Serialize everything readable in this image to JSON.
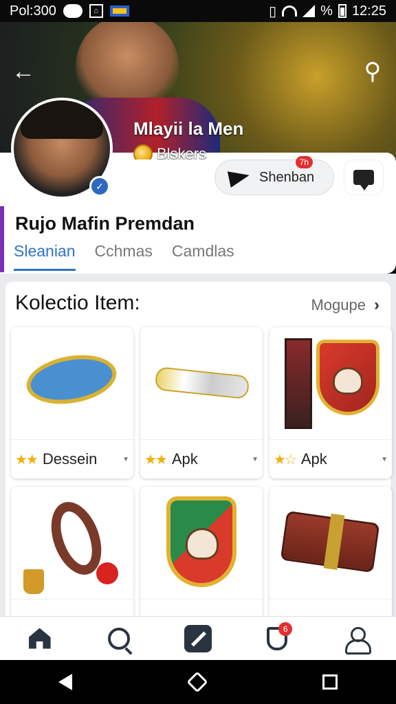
{
  "status_bar": {
    "carrier": "Pol:300",
    "battery_text": "%",
    "time": "12:25"
  },
  "hero": {
    "title": "Mlayii la Men",
    "subtitle": "Blskers"
  },
  "profile": {
    "share_button_label": "Shenban",
    "share_badge": "7h",
    "name": "Rujo Mafin Premdan",
    "tabs": [
      {
        "label": "Sleanian",
        "active": true
      },
      {
        "label": "Cchmas",
        "active": false
      },
      {
        "label": "Camdlas",
        "active": false
      }
    ]
  },
  "collection": {
    "title": "Kolectio Item:",
    "more_label": "Mogupe",
    "items": [
      {
        "label": "Dessein",
        "stars": "★★",
        "art": "disc"
      },
      {
        "label": "Apk",
        "stars": "★★",
        "art": "roll"
      },
      {
        "label": "Apk",
        "stars": "★☆",
        "art": "totem-shield"
      },
      {
        "label": "",
        "stars": "",
        "art": "ring"
      },
      {
        "label": "",
        "stars": "",
        "art": "shield"
      },
      {
        "label": "",
        "stars": "",
        "art": "chest"
      }
    ]
  },
  "bottom_nav": {
    "items": [
      {
        "icon": "home-icon"
      },
      {
        "icon": "search-icon"
      },
      {
        "icon": "pen-icon"
      },
      {
        "icon": "bookmark-icon",
        "badge": "6"
      },
      {
        "icon": "user-icon"
      }
    ]
  },
  "colors": {
    "accent": "#2f72c8",
    "profile_accent": "#7b2fb5",
    "badge": "#e03030"
  }
}
